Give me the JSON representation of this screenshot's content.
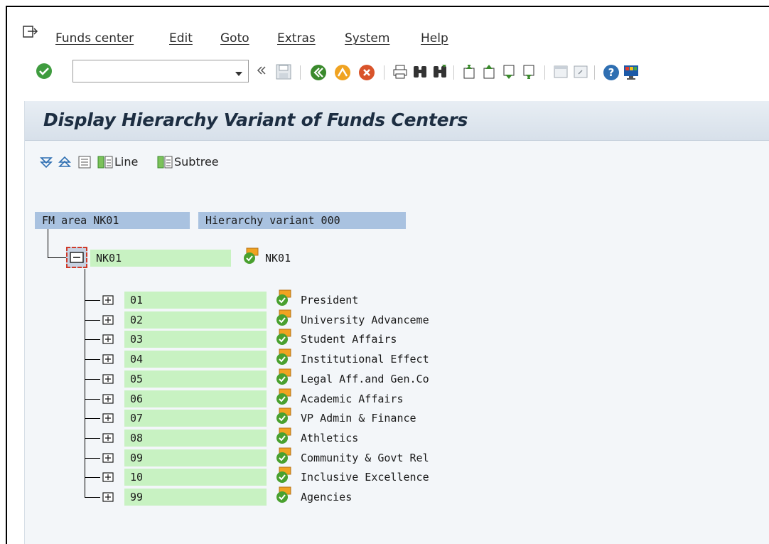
{
  "menu": {
    "items": [
      "Funds center",
      "Edit",
      "Goto",
      "Extras",
      "System",
      "Help"
    ]
  },
  "toolbar": {
    "command_value": ""
  },
  "page": {
    "title": "Display Hierarchy Variant of Funds Centers"
  },
  "app_toolbar": {
    "line_label": "Line",
    "subtree_label": "Subtree"
  },
  "tree": {
    "fm_area": "FM area NK01",
    "hierarchy_variant": "Hierarchy variant 000",
    "root": {
      "code": "NK01",
      "description": "NK01"
    },
    "children": [
      {
        "code": "01",
        "description": "President"
      },
      {
        "code": "02",
        "description": "University Advanceme"
      },
      {
        "code": "03",
        "description": "Student Affairs"
      },
      {
        "code": "04",
        "description": "Institutional Effect"
      },
      {
        "code": "05",
        "description": "Legal Aff.and Gen.Co"
      },
      {
        "code": "06",
        "description": "Academic Affairs"
      },
      {
        "code": "07",
        "description": "VP Admin & Finance"
      },
      {
        "code": "08",
        "description": "Athletics"
      },
      {
        "code": "09",
        "description": "Community & Govt Rel"
      },
      {
        "code": "10",
        "description": "Inclusive Excellence"
      },
      {
        "code": "99",
        "description": "Agencies"
      }
    ]
  },
  "colors": {
    "header_fill": "#a9c2e0",
    "node_fill": "#c8f2c2",
    "title_text": "#1d2e42"
  }
}
